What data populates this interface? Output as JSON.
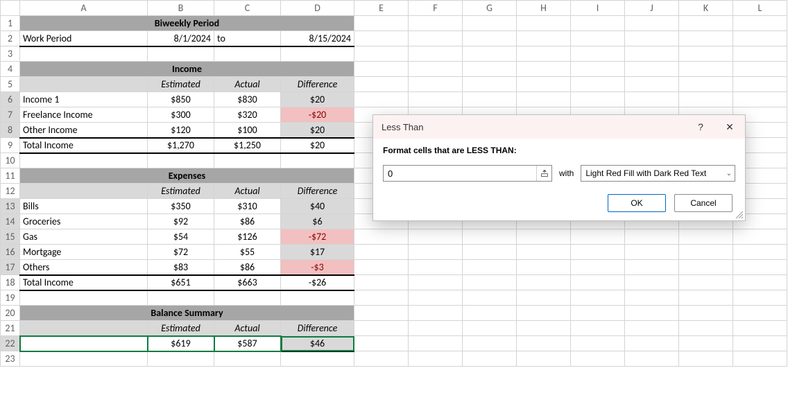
{
  "columns": [
    "A",
    "B",
    "C",
    "D",
    "E",
    "F",
    "G",
    "H",
    "I",
    "J",
    "K",
    "L"
  ],
  "rows": [
    "1",
    "2",
    "3",
    "4",
    "5",
    "6",
    "7",
    "8",
    "9",
    "10",
    "11",
    "12",
    "13",
    "14",
    "15",
    "16",
    "17",
    "18",
    "19",
    "20",
    "21",
    "22",
    "23"
  ],
  "sheet": {
    "r1": {
      "title": "Biweekly Period"
    },
    "r2": {
      "a": "Work Period",
      "b": "8/1/2024",
      "c": "to",
      "d": "8/15/2024"
    },
    "r4": {
      "title": "Income"
    },
    "r5": {
      "b": "Estimated",
      "c": "Actual",
      "d": "Difference"
    },
    "r6": {
      "a": "Income 1",
      "b": "$850",
      "c": "$830",
      "d": "$20"
    },
    "r7": {
      "a": "Freelance Income",
      "b": "$300",
      "c": "$320",
      "d": "-$20"
    },
    "r8": {
      "a": "Other Income",
      "b": "$120",
      "c": "$100",
      "d": "$20"
    },
    "r9": {
      "a": "Total Income",
      "b": "$1,270",
      "c": "$1,250",
      "d": "$20"
    },
    "r11": {
      "title": "Expenses"
    },
    "r12": {
      "b": "Estimated",
      "c": "Actual",
      "d": "Difference"
    },
    "r13": {
      "a": "Bills",
      "b": "$350",
      "c": "$310",
      "d": "$40"
    },
    "r14": {
      "a": "Groceries",
      "b": "$92",
      "c": "$86",
      "d": "$6"
    },
    "r15": {
      "a": "Gas",
      "b": "$54",
      "c": "$126",
      "d": "-$72"
    },
    "r16": {
      "a": "Mortgage",
      "b": "$72",
      "c": "$55",
      "d": "$17"
    },
    "r17": {
      "a": "Others",
      "b": "$83",
      "c": "$86",
      "d": "-$3"
    },
    "r18": {
      "a": "Total Income",
      "b": "$651",
      "c": "$663",
      "d": "-$26"
    },
    "r20": {
      "title": "Balance Summary"
    },
    "r21": {
      "b": "Estimated",
      "c": "Actual",
      "d": "Difference"
    },
    "r22": {
      "b": "$619",
      "c": "$587",
      "d": "$46"
    }
  },
  "dialog": {
    "title": "Less Than",
    "prompt": "Format cells that are LESS THAN:",
    "value": "0",
    "with_label": "with",
    "format_option": "Light Red Fill with Dark Red Text",
    "ok": "OK",
    "cancel": "Cancel",
    "help": "?",
    "close": "✕"
  }
}
